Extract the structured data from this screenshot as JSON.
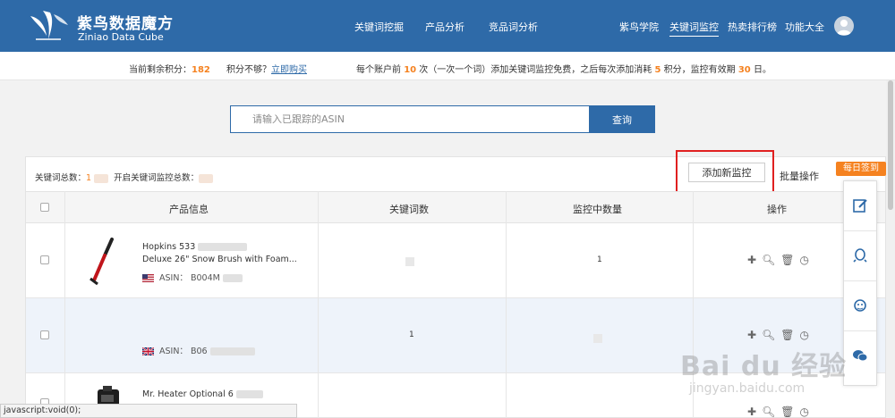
{
  "header": {
    "logo_cn": "紫鸟数据魔方",
    "logo_en": "Ziniao Data Cube",
    "nav_main": [
      "关键词挖掘",
      "产品分析",
      "竞品词分析"
    ],
    "nav_right": [
      "紫鸟学院",
      "关键词监控",
      "热卖排行榜",
      "功能大全"
    ],
    "active_nav": "关键词监控"
  },
  "infobar": {
    "points_label": "当前剩余积分：",
    "points_value": "182",
    "not_enough": "积分不够？",
    "buy_link": "立即购买",
    "notice_1": "每个账户前",
    "notice_count": "10",
    "notice_2": "次（一次一个词）添加关键词监控免费，之后每次添加消耗",
    "notice_cost": "5",
    "notice_3": "积分，监控有效期",
    "notice_days": "30",
    "notice_4": "日。"
  },
  "search": {
    "placeholder": "请输入已跟踪的ASIN",
    "button": "查询"
  },
  "panel": {
    "total_label": "关键词总数：",
    "total_value": "1",
    "open_label": "开启关键词监控总数：",
    "add_button": "添加新监控",
    "batch": "批量操作"
  },
  "table": {
    "headers": [
      "产品信息",
      "关键词数",
      "监控中数量",
      "操作"
    ],
    "rows": [
      {
        "name_line1": "Hopkins 533",
        "name_line2": "Deluxe 26\" Snow Brush with Foam...",
        "asin": "ASIN： B004M",
        "flag": "US",
        "monitor_count": "1"
      },
      {
        "name_line1": "",
        "name_line2": "",
        "asin": "ASIN： B06",
        "flag": "UK",
        "keyword_count": "1"
      },
      {
        "name_line1": "Mr. Heater Optional 6",
        "name_line2": "",
        "asin": "",
        "flag": ""
      }
    ]
  },
  "sidebar": {
    "sign_tag": "每日签到"
  },
  "status_bar": "javascript:void(0);",
  "watermark": {
    "big": "Bai du 经验",
    "small": "jingyan.baidu.com"
  }
}
